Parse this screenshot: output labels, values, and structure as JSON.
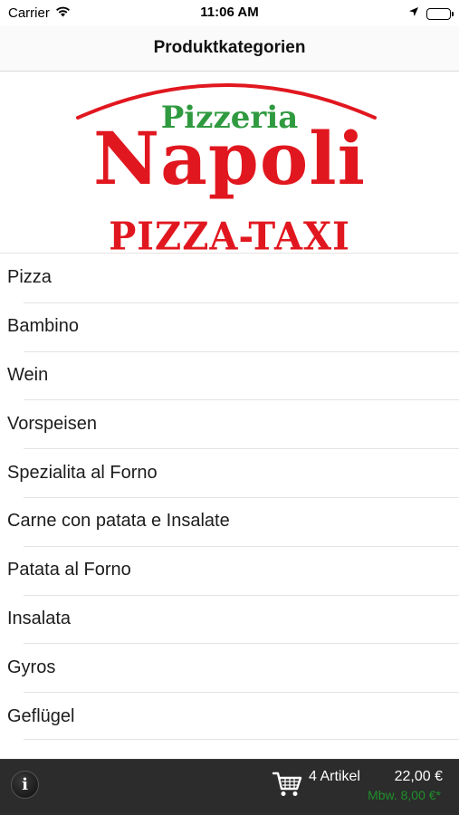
{
  "status_bar": {
    "carrier": "Carrier",
    "time": "11:06 AM"
  },
  "nav": {
    "title": "Produktkategorien"
  },
  "logo": {
    "line1": "Pizzeria",
    "line2": "Napoli",
    "line3": "PIZZA-TAXI",
    "colors": {
      "red": "#e1171f",
      "green": "#2f9a3f"
    }
  },
  "categories": [
    {
      "label": "Pizza"
    },
    {
      "label": "Bambino"
    },
    {
      "label": "Wein"
    },
    {
      "label": "Vorspeisen"
    },
    {
      "label": "Spezialita al Forno"
    },
    {
      "label": "Carne con patata e Insalate"
    },
    {
      "label": "Patata al Forno"
    },
    {
      "label": "Insalata"
    },
    {
      "label": "Gyros"
    },
    {
      "label": "Geflügel"
    }
  ],
  "toolbar": {
    "info_icon": "info-icon",
    "cart_icon": "shopping-cart-icon",
    "item_count": "4 Artikel",
    "total": "22,00 €",
    "minimum_order": "Mbw. 8,00 €*",
    "colors": {
      "background": "#2c2c2c",
      "minimum": "#1f8f2a"
    }
  }
}
